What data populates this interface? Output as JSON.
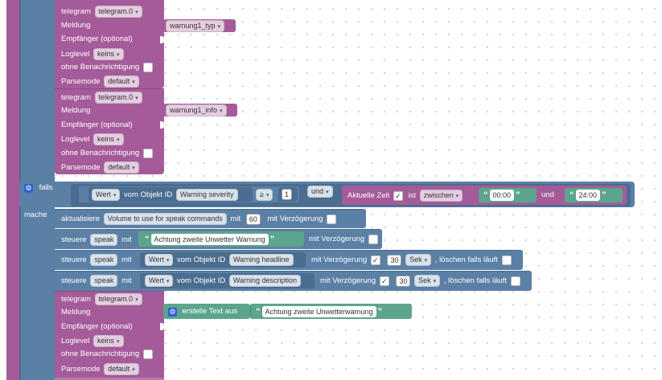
{
  "telegram_block": {
    "telegram_label": "telegram",
    "instance": "telegram.0",
    "meldung_label": "Meldung",
    "empfaenger_label": "Empfänger (optional)",
    "loglevel_label": "Loglevel",
    "loglevel_value": "keins",
    "ohne_label": "ohne Benachrichtigung",
    "parsemode_label": "Parsemode",
    "parsemode_value": "default"
  },
  "msg1_var": "warnung1_typ",
  "msg2_var": "warnung1_info",
  "falls_block": {
    "falls_label": "falls",
    "mache_label": "mache",
    "wert_label": "Wert",
    "vom_objekt_label": "vom Objekt ID",
    "object_severity": "Warning severity",
    "operator": "≥",
    "compare_value": "1",
    "und_label": "und",
    "aktuelle_zeit_label": "Aktuelle Zeit",
    "ist_label": "ist",
    "zwischen_label": "zwischen",
    "time_from": "00:00",
    "und2_label": "und",
    "time_to": "24:00"
  },
  "aktualisiere": {
    "label": "aktualisiere",
    "object": "Volume to use for speak commands",
    "mit_label": "mit",
    "value": "60",
    "delay_label": "mit Verzögerung"
  },
  "steuere1": {
    "label": "steuere",
    "target": "speak",
    "mit_label": "mit",
    "text": "Achtung zweite Unwetter Warnung",
    "delay_label": "mit Verzögerung"
  },
  "steuere2": {
    "label": "steuere",
    "target": "speak",
    "mit_label": "mit",
    "wert_label": "Wert",
    "vom_objekt_label": "vom Objekt ID",
    "object": "Warning headline",
    "delay_label": "mit Verzögerung",
    "delay_value": "30",
    "unit": "Sek",
    "clear_label": ", löschen falls läuft"
  },
  "steuere3": {
    "label": "steuere",
    "target": "speak",
    "mit_label": "mit",
    "wert_label": "Wert",
    "vom_objekt_label": "vom Objekt ID",
    "object": "Warning description",
    "delay_label": "mit Verzögerung",
    "delay_value": "30",
    "unit": "Sek",
    "clear_label": ", löschen falls läuft"
  },
  "telegram3": {
    "erstelle_label": "erstelle Text aus",
    "text": "Achtung zweite Unwetterwarnung"
  },
  "checkmark": "✓",
  "quote_open": "“",
  "quote_close": "”",
  "dropdown_arrow": "▾"
}
